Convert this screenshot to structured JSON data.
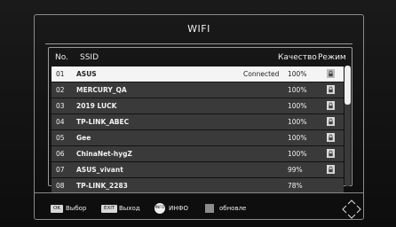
{
  "window": {
    "title": "WIFI"
  },
  "columns": {
    "no": "No.",
    "ssid": "SSID",
    "quality": "Качество",
    "mode": "Режим"
  },
  "networks": [
    {
      "no": "01",
      "ssid": "ASUS",
      "status": "Connected",
      "quality": "100%",
      "secured": true,
      "selected": true
    },
    {
      "no": "02",
      "ssid": "MERCURY_QA",
      "status": "",
      "quality": "100%",
      "secured": true,
      "selected": false
    },
    {
      "no": "03",
      "ssid": "2019 LUCK",
      "status": "",
      "quality": "100%",
      "secured": true,
      "selected": false
    },
    {
      "no": "04",
      "ssid": "TP-LINK_ABEC",
      "status": "",
      "quality": "100%",
      "secured": true,
      "selected": false
    },
    {
      "no": "05",
      "ssid": "Gee",
      "status": "",
      "quality": "100%",
      "secured": true,
      "selected": false
    },
    {
      "no": "06",
      "ssid": "ChinaNet-hygZ",
      "status": "",
      "quality": "100%",
      "secured": true,
      "selected": false
    },
    {
      "no": "07",
      "ssid": "ASUS_vivant",
      "status": "",
      "quality": "99%",
      "secured": true,
      "selected": false
    },
    {
      "no": "08",
      "ssid": "TP-LINK_2283",
      "status": "",
      "quality": "78%",
      "secured": false,
      "selected": false
    }
  ],
  "footer": {
    "ok_key": "OK",
    "ok_label": "Выбор",
    "exit_key": "EXIT",
    "exit_label": "Выход",
    "info_key": "INFO",
    "info_label": "ИНФО",
    "refresh_label": "обновле"
  },
  "icons": {
    "lock": "lock-icon",
    "dpad": "dpad-arrows-icon"
  },
  "colors": {
    "selected_row": "#f4f4f4",
    "row": "#3a3a3a",
    "background": "#121212"
  },
  "scroll": {
    "position": 0.0,
    "visible_fraction": 0.32
  }
}
